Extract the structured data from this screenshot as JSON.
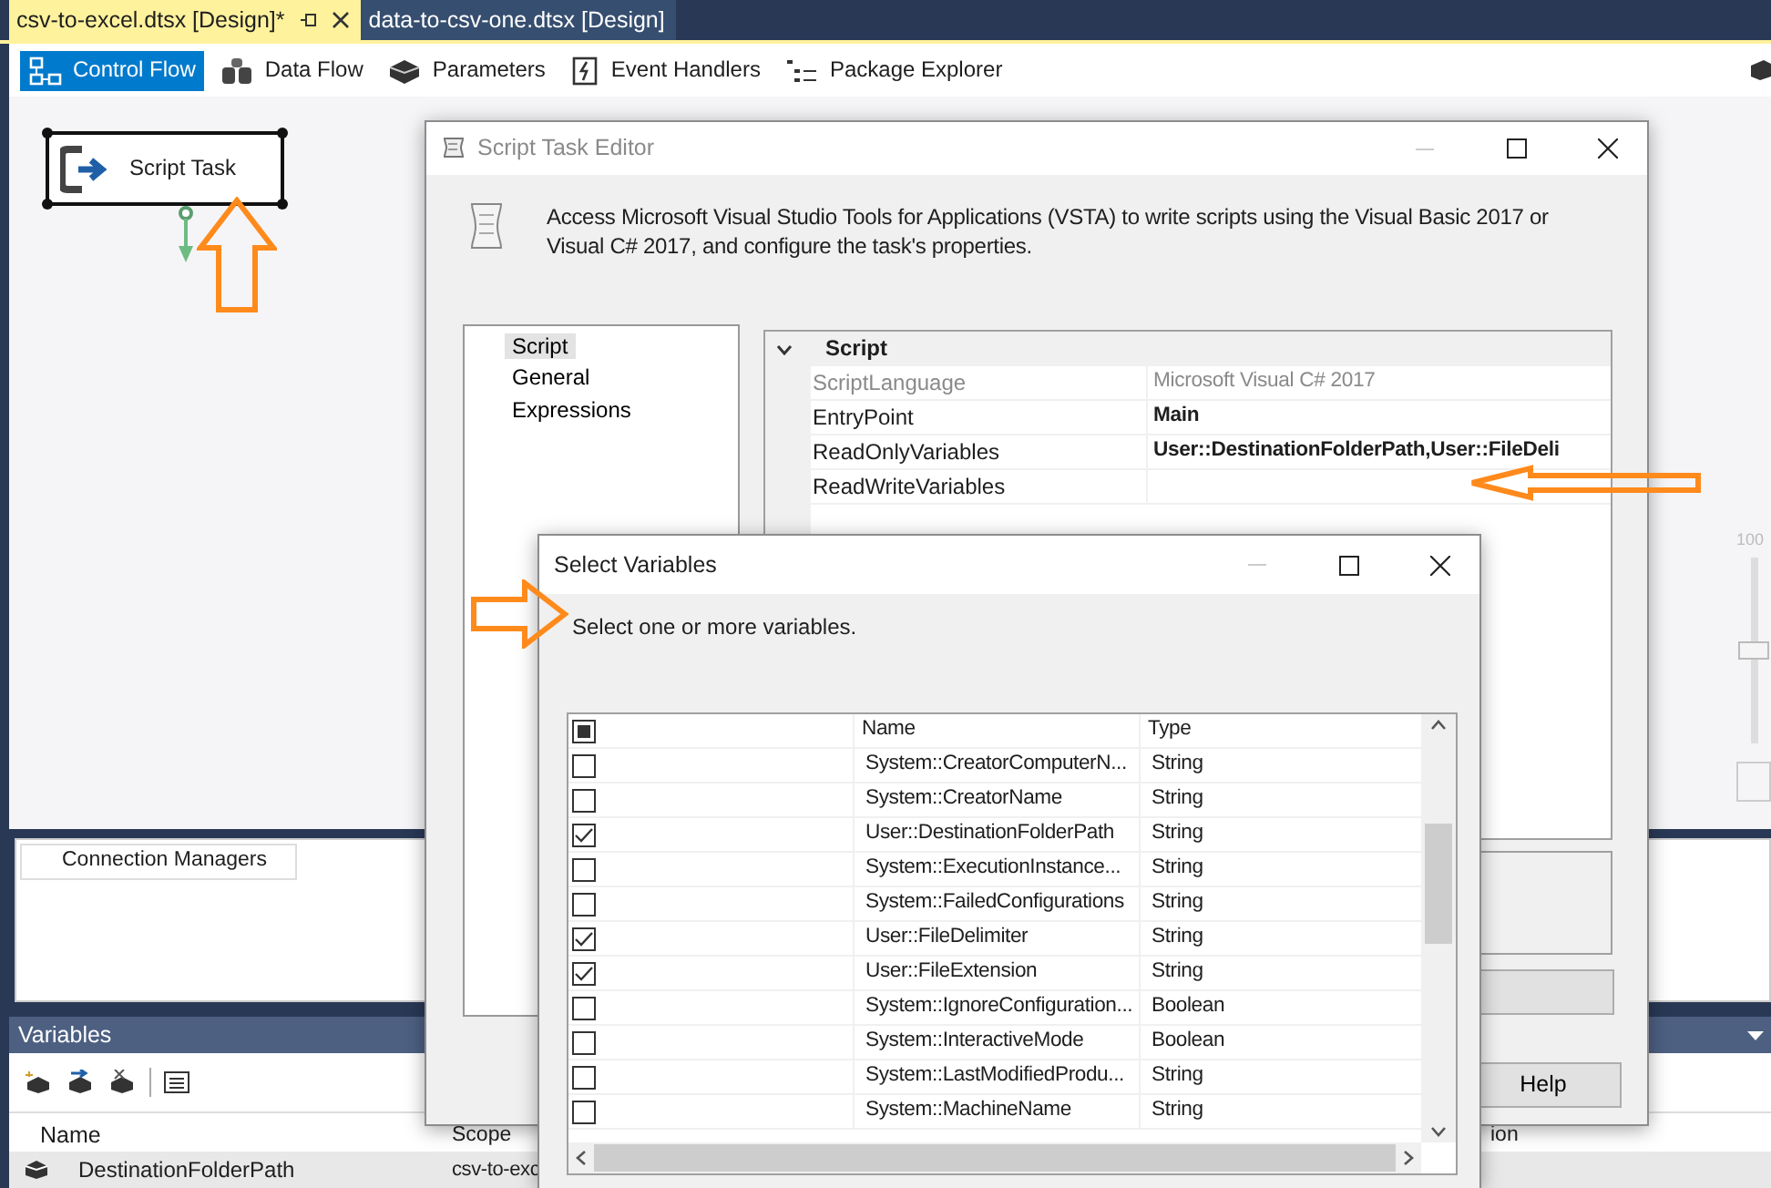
{
  "document_tabs": [
    {
      "label": "csv-to-excel.dtsx [Design]*",
      "selected": true
    },
    {
      "label": "data-to-csv-one.dtsx [Design]",
      "selected": false
    }
  ],
  "designer_tabs": [
    {
      "label": "Control Flow",
      "selected": true
    },
    {
      "label": "Data Flow",
      "selected": false
    },
    {
      "label": "Parameters",
      "selected": false
    },
    {
      "label": "Event Handlers",
      "selected": false
    },
    {
      "label": "Package Explorer",
      "selected": false
    }
  ],
  "canvas": {
    "task": {
      "label": "Script Task"
    },
    "zoom_label": "100",
    "zoom_slider": {
      "level": 0.5
    }
  },
  "connection_managers": {
    "tab": "Connection Managers"
  },
  "variables_panel": {
    "title": "Variables",
    "columns": [
      "Name",
      "Scope",
      "ion"
    ],
    "rows": [
      {
        "name": "DestinationFolderPath",
        "scope": "csv-to-exc"
      }
    ]
  },
  "script_task_editor": {
    "title": "Script Task Editor",
    "description": "Access Microsoft Visual Studio Tools for Applications (VSTA) to write scripts using the Visual Basic 2017 or Visual C# 2017, and configure the task's properties.",
    "pages": [
      {
        "label": "Script",
        "selected": true
      },
      {
        "label": "General",
        "selected": false
      },
      {
        "label": "Expressions",
        "selected": false
      }
    ],
    "property_grid": {
      "category": "Script",
      "expanded": true,
      "rows": [
        {
          "name": "ScriptLanguage",
          "value": "Microsoft Visual C# 2017",
          "disabled": true,
          "modified": false
        },
        {
          "name": "EntryPoint",
          "value": "Main",
          "disabled": false,
          "modified": true
        },
        {
          "name": "ReadOnlyVariables",
          "value": "User::DestinationFolderPath,User::FileDeli",
          "disabled": false,
          "modified": true
        },
        {
          "name": "ReadWriteVariables",
          "disabled": false
        }
      ]
    },
    "buttons": [
      "Help"
    ]
  },
  "select_variables": {
    "title": "Select Variables",
    "prompt": "Select one or more variables.",
    "header_checkbox": {
      "indeterminate": true
    },
    "columns": [
      "Name",
      "Type"
    ],
    "rows": [
      {
        "checked": false,
        "name": "System::CreatorComputerN...",
        "type": "String"
      },
      {
        "checked": false,
        "name": "System::CreatorName",
        "type": "String"
      },
      {
        "checked": true,
        "name": "User::DestinationFolderPath",
        "type": "String"
      },
      {
        "checked": false,
        "name": "System::ExecutionInstance...",
        "type": "String"
      },
      {
        "checked": false,
        "name": "System::FailedConfigurations",
        "type": "String"
      },
      {
        "checked": true,
        "name": "User::FileDelimiter",
        "type": "String"
      },
      {
        "checked": true,
        "name": "User::FileExtension",
        "type": "String"
      },
      {
        "checked": false,
        "name": "System::IgnoreConfiguration...",
        "type": "Boolean"
      },
      {
        "checked": false,
        "name": "System::InteractiveMode",
        "type": "Boolean"
      },
      {
        "checked": false,
        "name": "System::LastModifiedProdu...",
        "type": "String"
      },
      {
        "checked": false,
        "name": "System::MachineName",
        "type": "String"
      }
    ]
  }
}
